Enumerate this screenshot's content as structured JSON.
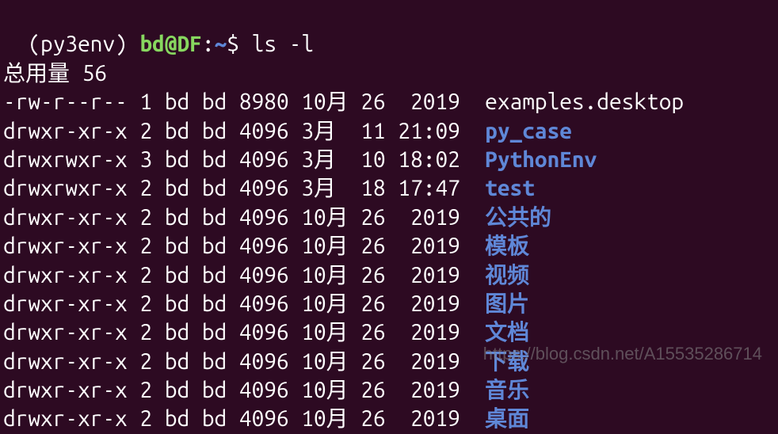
{
  "prompt": {
    "env": "(py3env) ",
    "user_host": "bd@DF",
    "colon": ":",
    "path": "~",
    "dollar": "$ ",
    "command": "ls -l"
  },
  "total": "总用量 56",
  "rows": [
    {
      "perms": "-rw-r--r--",
      "links": "1",
      "owner": "bd",
      "group": "bd",
      "size": "8980",
      "month": "10月",
      "day": "26",
      "time": " 2019",
      "name": "examples.desktop",
      "is_dir": false
    },
    {
      "perms": "drwxr-xr-x",
      "links": "2",
      "owner": "bd",
      "group": "bd",
      "size": "4096",
      "month": "3月 ",
      "day": "11",
      "time": "21:09",
      "name": "py_case",
      "is_dir": true
    },
    {
      "perms": "drwxrwxr-x",
      "links": "3",
      "owner": "bd",
      "group": "bd",
      "size": "4096",
      "month": "3月 ",
      "day": "10",
      "time": "18:02",
      "name": "PythonEnv",
      "is_dir": true
    },
    {
      "perms": "drwxrwxr-x",
      "links": "2",
      "owner": "bd",
      "group": "bd",
      "size": "4096",
      "month": "3月 ",
      "day": "18",
      "time": "17:47",
      "name": "test",
      "is_dir": true
    },
    {
      "perms": "drwxr-xr-x",
      "links": "2",
      "owner": "bd",
      "group": "bd",
      "size": "4096",
      "month": "10月",
      "day": "26",
      "time": " 2019",
      "name": "公共的",
      "is_dir": true
    },
    {
      "perms": "drwxr-xr-x",
      "links": "2",
      "owner": "bd",
      "group": "bd",
      "size": "4096",
      "month": "10月",
      "day": "26",
      "time": " 2019",
      "name": "模板",
      "is_dir": true
    },
    {
      "perms": "drwxr-xr-x",
      "links": "2",
      "owner": "bd",
      "group": "bd",
      "size": "4096",
      "month": "10月",
      "day": "26",
      "time": " 2019",
      "name": "视频",
      "is_dir": true
    },
    {
      "perms": "drwxr-xr-x",
      "links": "2",
      "owner": "bd",
      "group": "bd",
      "size": "4096",
      "month": "10月",
      "day": "26",
      "time": " 2019",
      "name": "图片",
      "is_dir": true
    },
    {
      "perms": "drwxr-xr-x",
      "links": "2",
      "owner": "bd",
      "group": "bd",
      "size": "4096",
      "month": "10月",
      "day": "26",
      "time": " 2019",
      "name": "文档",
      "is_dir": true
    },
    {
      "perms": "drwxr-xr-x",
      "links": "2",
      "owner": "bd",
      "group": "bd",
      "size": "4096",
      "month": "10月",
      "day": "26",
      "time": " 2019",
      "name": "下载",
      "is_dir": true
    },
    {
      "perms": "drwxr-xr-x",
      "links": "2",
      "owner": "bd",
      "group": "bd",
      "size": "4096",
      "month": "10月",
      "day": "26",
      "time": " 2019",
      "name": "音乐",
      "is_dir": true
    },
    {
      "perms": "drwxr-xr-x",
      "links": "2",
      "owner": "bd",
      "group": "bd",
      "size": "4096",
      "month": "10月",
      "day": "26",
      "time": " 2019",
      "name": "桌面",
      "is_dir": true
    }
  ],
  "watermark": "https://blog.csdn.net/A15535286714"
}
